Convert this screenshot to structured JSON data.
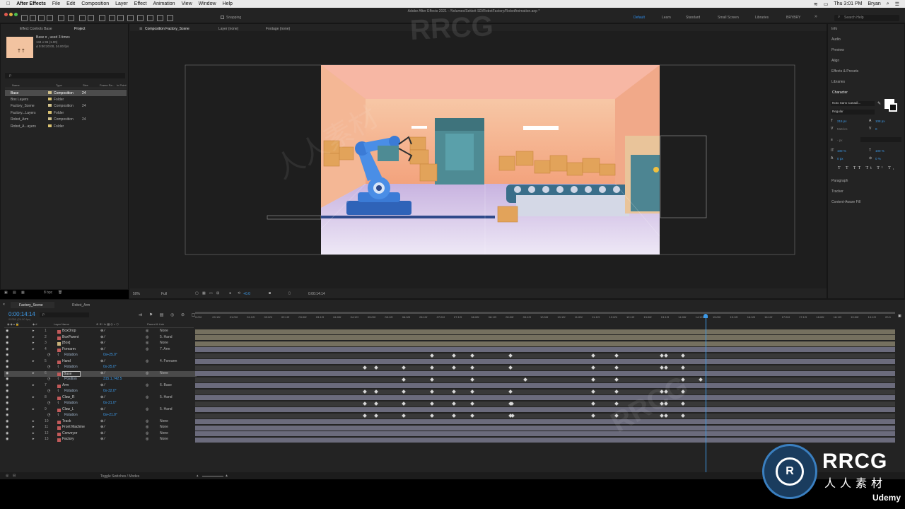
{
  "menubar": {
    "app": "After Effects",
    "items": [
      "File",
      "Edit",
      "Composition",
      "Layer",
      "Effect",
      "Animation",
      "View",
      "Window",
      "Help"
    ],
    "clock": "Thu 3:01 PM",
    "user": "Bryan"
  },
  "toolbar": {
    "window_title": "Adobe After Effects 2021 - /Volumes/Sekkrit SD/RobotFactory/RobotAnimation.aep *",
    "snapping": "Snapping",
    "workspaces": [
      "Default",
      "Learn",
      "Standard",
      "Small Screen",
      "Libraries",
      "BRYBRY"
    ],
    "search_placeholder": "Search Help"
  },
  "project_panel": {
    "tabs": [
      "Effect Controls Base",
      "Project"
    ],
    "selected_name": "Base ▾ , used 3 times",
    "selected_info": [
      "134 x 95 (1.00)",
      "Δ 0:00:20:00, 24.00 fps"
    ],
    "search_placeholder": "ρ",
    "columns": [
      "Name",
      "Type",
      "Size",
      "Frame Ra...",
      "In Point"
    ],
    "items": [
      {
        "name": "Base",
        "type": "Composition",
        "fps": "24",
        "color": "#d0c08a",
        "selected": true
      },
      {
        "name": "Box Layers",
        "type": "Folder",
        "fps": "",
        "color": "#d8c070"
      },
      {
        "name": "Factory_Scene",
        "type": "Composition",
        "fps": "24",
        "color": "#d0c08a"
      },
      {
        "name": "Factory...Layers",
        "type": "Folder",
        "fps": "",
        "color": "#d8c070"
      },
      {
        "name": "Robot_Arm",
        "type": "Composition",
        "fps": "24",
        "color": "#d0c08a"
      },
      {
        "name": "Robot_A...ayers",
        "type": "Folder",
        "fps": "",
        "color": "#d8c070"
      }
    ],
    "footer_bpc": "8 bpc"
  },
  "comp_panel": {
    "tabs": [
      "Composition Factory_Scene",
      "Layer (none)",
      "Footage (none)"
    ],
    "breadcrumbs": [
      "Factory_Scene",
      "Box"
    ],
    "zoom": "50%",
    "resolution": "Full",
    "exposure": "+0.0",
    "timecode": "0:00:14:14"
  },
  "right_panel": {
    "sections": [
      "Info",
      "Audio",
      "Preview",
      "Align",
      "Effects & Presets",
      "Libraries"
    ],
    "character_title": "Character",
    "font": "Noto Sans Canadi...",
    "style": "Regular",
    "font_size": "215 px",
    "leading": "108 px",
    "kerning": "Metrics",
    "tracking": "0",
    "stroke_unit": "- px",
    "v_scale": "100 %",
    "h_scale": "100 %",
    "baseline": "0 px",
    "tsume": "0 %",
    "lower_sections": [
      "Paragraph",
      "Tracker",
      "Content-Aware Fill"
    ]
  },
  "timeline": {
    "tabs": [
      "Factory_Scene",
      "Robot_Arm"
    ],
    "timecode": "0:00:14:14",
    "frames": "00350 (24.00 fps)",
    "col_layer_name": "Layer Name",
    "col_parent": "Parent & Link",
    "ruler": [
      "0:00f",
      "00:12f",
      "01:00f",
      "01:12f",
      "02:00f",
      "02:12f",
      "03:00f",
      "03:12f",
      "04:00f",
      "04:12f",
      "05:00f",
      "05:12f",
      "06:00f",
      "06:12f",
      "07:00f",
      "07:12f",
      "08:00f",
      "08:12f",
      "09:00f",
      "09:12f",
      "10:00f",
      "10:12f",
      "11:00f",
      "11:12f",
      "12:00f",
      "12:12f",
      "13:00f",
      "13:12f",
      "14:00f",
      "14:12f",
      "15:00f",
      "15:12f",
      "16:00f",
      "16:12f",
      "17:00f",
      "17:12f",
      "18:00f",
      "18:12f",
      "19:00f",
      "19:12f",
      "20:0"
    ],
    "playhead_fraction": 0.729,
    "layers": [
      {
        "num": "1",
        "name": "BoxDrop",
        "parent": "None",
        "color": "#c15a5a",
        "kind": "layer"
      },
      {
        "num": "2",
        "name": "BoxParent",
        "parent": "5. Hand",
        "color": "#c15a5a",
        "kind": "layer"
      },
      {
        "num": "3",
        "name": "[Box]",
        "parent": "None",
        "color": "#c8b27a",
        "kind": "layer"
      },
      {
        "num": "4",
        "name": "Forearm",
        "parent": "7. Arm",
        "color": "#c15a5a",
        "kind": "layer"
      },
      {
        "num": "",
        "name": "Rotation",
        "value": "0x+25.0°",
        "kind": "prop"
      },
      {
        "num": "5",
        "name": "Hand",
        "parent": "4. Forearm",
        "color": "#c15a5a",
        "kind": "layer"
      },
      {
        "num": "",
        "name": "Rotation",
        "value": "0x-25.0°",
        "kind": "prop"
      },
      {
        "num": "6",
        "name": "Base",
        "parent": "None",
        "color": "#c15a5a",
        "kind": "layer",
        "selected": true
      },
      {
        "num": "",
        "name": "Position",
        "value": "315.1,742.5",
        "kind": "prop"
      },
      {
        "num": "7",
        "name": "Arm",
        "parent": "6. Base",
        "color": "#c15a5a",
        "kind": "layer"
      },
      {
        "num": "",
        "name": "Rotation",
        "value": "0x-32.0°",
        "kind": "prop"
      },
      {
        "num": "8",
        "name": "Claw_R",
        "parent": "5. Hand",
        "color": "#c15a5a",
        "kind": "layer"
      },
      {
        "num": "",
        "name": "Rotation",
        "value": "0x-21.0°",
        "kind": "prop"
      },
      {
        "num": "9",
        "name": "Claw_L",
        "parent": "5. Hand",
        "color": "#c15a5a",
        "kind": "layer"
      },
      {
        "num": "",
        "name": "Rotation",
        "value": "0x+21.0°",
        "kind": "prop"
      },
      {
        "num": "10",
        "name": "Track",
        "parent": "None",
        "color": "#c15a5a",
        "kind": "layer"
      },
      {
        "num": "11",
        "name": "Front Machine",
        "parent": "None",
        "color": "#c15a5a",
        "kind": "layer"
      },
      {
        "num": "12",
        "name": "Conveyor",
        "parent": "None",
        "color": "#c15a5a",
        "kind": "layer"
      },
      {
        "num": "13",
        "name": "Factory",
        "parent": "None",
        "color": "#c15a5a",
        "kind": "layer"
      }
    ],
    "footer_toggle": "Toggle Switches / Modes"
  },
  "branding": {
    "watermark": "RRCG",
    "watermark_cn": "人人素材",
    "logo_text": "RRCG",
    "logo_sub": "人人素材",
    "udemy": "Udemy"
  }
}
